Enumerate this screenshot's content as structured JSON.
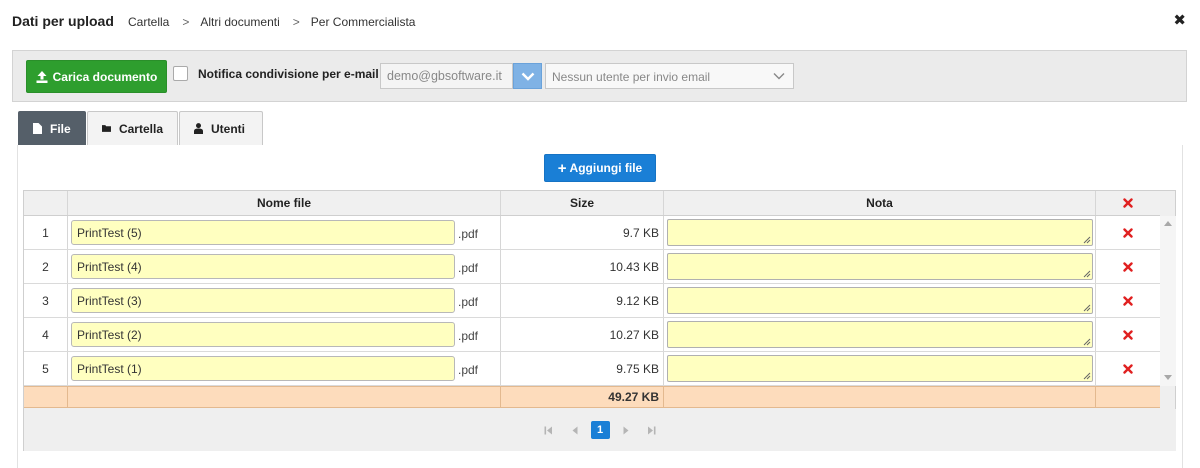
{
  "header": {
    "title": "Dati per upload",
    "breadcrumb": [
      "Cartella",
      "Altri documenti",
      "Per Commercialista"
    ]
  },
  "toolbar": {
    "upload_label": "Carica documento",
    "notify_label": "Notifica condivisione per e-mail",
    "notify_checked": false,
    "email_value": "demo@gbsoftware.it",
    "user_select_value": "Nessun utente per invio email"
  },
  "tabs": [
    {
      "label": "File",
      "icon": "file-icon",
      "active": true
    },
    {
      "label": "Cartella",
      "icon": "folder-icon",
      "active": false
    },
    {
      "label": "Utenti",
      "icon": "user-icon",
      "active": false
    }
  ],
  "add_file_label": "Aggiungi file",
  "grid": {
    "columns": {
      "name": "Nome file",
      "size": "Size",
      "nota": "Nota"
    },
    "rows": [
      {
        "num": "1",
        "name": "PrintTest (5)",
        "ext": ".pdf",
        "size": "9.7 KB",
        "nota": ""
      },
      {
        "num": "2",
        "name": "PrintTest (4)",
        "ext": ".pdf",
        "size": "10.43 KB",
        "nota": ""
      },
      {
        "num": "3",
        "name": "PrintTest (3)",
        "ext": ".pdf",
        "size": "9.12 KB",
        "nota": ""
      },
      {
        "num": "4",
        "name": "PrintTest (2)",
        "ext": ".pdf",
        "size": "10.27 KB",
        "nota": ""
      },
      {
        "num": "5",
        "name": "PrintTest (1)",
        "ext": ".pdf",
        "size": "9.75 KB",
        "nota": ""
      }
    ],
    "total_size": "49.27 KB"
  },
  "pager": {
    "current_page": "1"
  },
  "colors": {
    "upload_green": "#2e9e2e",
    "primary_blue": "#1a7fd6",
    "active_tab": "#555f69",
    "input_yellow": "#ffffc0",
    "footer_orange": "#fddcbc",
    "delete_red": "#e02020"
  }
}
